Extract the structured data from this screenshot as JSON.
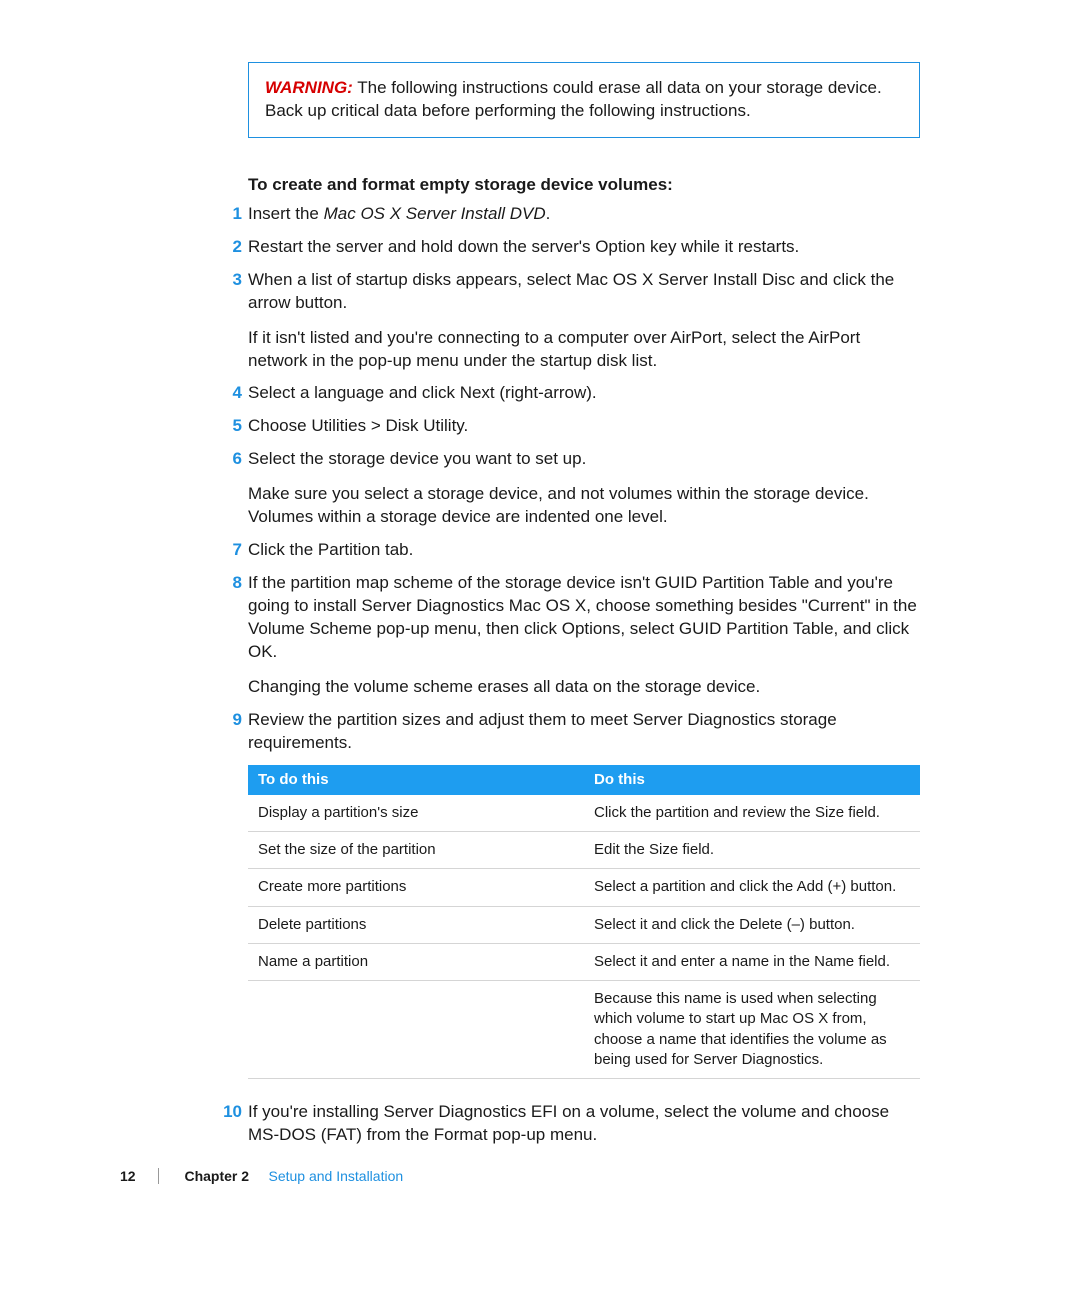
{
  "warning": {
    "label": "WARNING:",
    "text": "The following instructions could erase all data on your storage device. Back up critical data before performing the following instructions."
  },
  "heading": "To create and format empty storage device volumes:",
  "steps": [
    {
      "num": "1",
      "parts": [
        {
          "pre": "Insert the ",
          "em": "Mac OS X Server Install DVD",
          "post": "."
        }
      ]
    },
    {
      "num": "2",
      "parts": [
        {
          "text": "Restart the server and hold down the server's Option key while it restarts."
        }
      ]
    },
    {
      "num": "3",
      "parts": [
        {
          "text": "When a list of startup disks appears, select Mac OS X Server Install Disc and click the arrow button."
        },
        {
          "text": "If it isn't listed and you're connecting to a computer over AirPort, select the AirPort network in the pop-up menu under the startup disk list."
        }
      ]
    },
    {
      "num": "4",
      "parts": [
        {
          "text": "Select a language and click Next (right-arrow)."
        }
      ]
    },
    {
      "num": "5",
      "parts": [
        {
          "text": "Choose Utilities > Disk Utility."
        }
      ]
    },
    {
      "num": "6",
      "parts": [
        {
          "text": "Select the storage device you want to set up."
        },
        {
          "text": "Make sure you select a storage device, and not volumes within the storage device. Volumes within a storage device are indented one level."
        }
      ]
    },
    {
      "num": "7",
      "parts": [
        {
          "text": "Click the Partition tab."
        }
      ]
    },
    {
      "num": "8",
      "parts": [
        {
          "text": "If the partition map scheme of the storage device isn't GUID Partition Table and you're going to install Server Diagnostics Mac OS X, choose something besides \"Current\" in the Volume Scheme pop-up menu, then click Options, select GUID Partition Table, and click OK."
        },
        {
          "text": "Changing the volume scheme erases all data on the storage device."
        }
      ]
    },
    {
      "num": "9",
      "parts": [
        {
          "text": "Review the partition sizes and adjust them to meet Server Diagnostics storage requirements."
        }
      ]
    }
  ],
  "table": {
    "head": {
      "left": "To do this",
      "right": "Do this"
    },
    "rows": [
      {
        "left": "Display a partition's size",
        "right": "Click the partition and review the Size field."
      },
      {
        "left": "Set the size of the partition",
        "right": "Edit the Size field."
      },
      {
        "left": "Create more partitions",
        "right": "Select a partition and click the Add (+) button."
      },
      {
        "left": "Delete partitions",
        "right": "Select it and click the Delete (–) button."
      },
      {
        "left": "Name a partition",
        "right": "Select it and enter a name in the Name field."
      },
      {
        "left": "",
        "right": "Because this name is used when selecting which volume to start up Mac OS X from, choose a name that identifies the volume as being used for Server Diagnostics."
      }
    ]
  },
  "step10": {
    "num": "10",
    "text": "If you're installing Server Diagnostics EFI on a volume, select the volume and choose MS-DOS (FAT) from the Format pop-up menu."
  },
  "footer": {
    "page": "12",
    "chapter_label": "Chapter 2",
    "chapter_title": "Setup and Installation"
  }
}
